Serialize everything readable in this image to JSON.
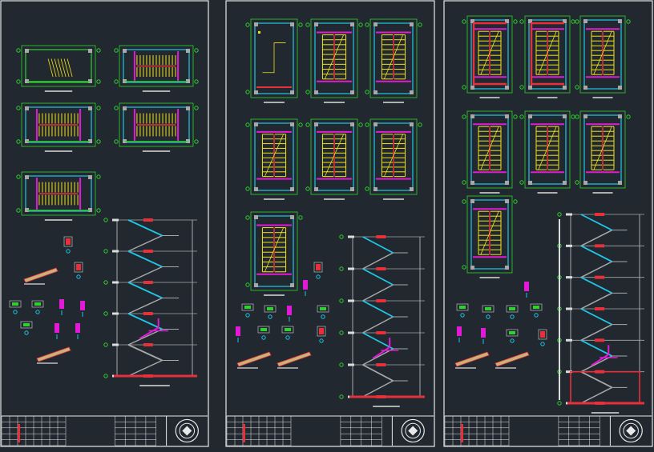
{
  "app": {
    "canvas_color": "#212830"
  },
  "colors": {
    "frame": "#e8e8e8",
    "wall_green": "#2fd12f",
    "wall_cyan": "#1fc6e6",
    "stair_yellow": "#f2e21a",
    "beam_magenta": "#e11ad6",
    "slab_red": "#e8303a",
    "column_gray": "#a8a8a8",
    "hatch_tan": "#c9b27a",
    "text_white": "#dcdcdc"
  },
  "sheets": [
    {
      "id": "sheet-1",
      "plans": [
        {
          "label": "—"
        },
        {
          "label": "—"
        },
        {
          "label": "—"
        },
        {
          "label": "—"
        },
        {
          "label": "—"
        }
      ],
      "section": {
        "floors": 5
      },
      "details": 9
    },
    {
      "id": "sheet-2",
      "plans": [
        {
          "label": "—"
        },
        {
          "label": "—"
        },
        {
          "label": "—"
        },
        {
          "label": "—"
        },
        {
          "label": "—"
        },
        {
          "label": "—"
        },
        {
          "label": "—"
        }
      ],
      "section": {
        "floors": 5
      },
      "details": 10
    },
    {
      "id": "sheet-3",
      "plans": [
        {
          "label": "—"
        },
        {
          "label": "—"
        },
        {
          "label": "—"
        },
        {
          "label": "—"
        },
        {
          "label": "—"
        },
        {
          "label": "—"
        },
        {
          "label": "—"
        }
      ],
      "section": {
        "floors": 6
      },
      "details": 10
    }
  ],
  "title_block": {
    "icon": "company-seal-icon"
  }
}
